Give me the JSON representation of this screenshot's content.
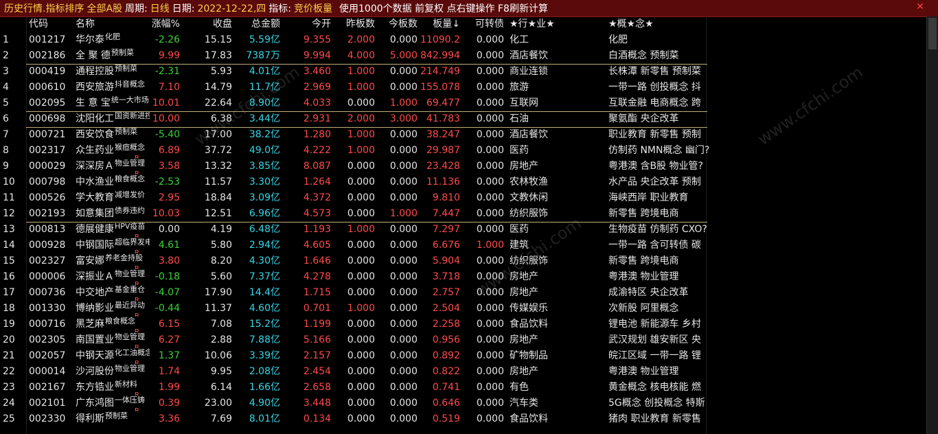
{
  "titlebar": {
    "title": "历史行情.指标排序",
    "market": "全部A股",
    "period_label": "周期:",
    "period_value": "日线",
    "date_label": "日期:",
    "date_value": "2022-12-22,四",
    "indicator_label": "指标:",
    "indicator_value": "竞价板量",
    "info": "使用1000个数据 前复权 点右键操作 F8刷新计算",
    "close": "✕"
  },
  "watermark": "www.cfchi.com",
  "headers": [
    "代码",
    "名称",
    "涨幅%",
    "收盘",
    "总金额",
    "今开",
    "昨板数",
    "今板数",
    "板量↓",
    "可转债",
    "★行★业★",
    "★概★念★"
  ],
  "rows": [
    {
      "idx": "1",
      "code": "001217",
      "name": "华尔泰",
      "tag": "化肥",
      "r": false,
      "pct": "-2.26",
      "close": "15.15",
      "amt": "5.59亿",
      "open": "9.355",
      "prev": "2.000",
      "today": "0.000",
      "board": "11090.2",
      "conv": "0.000",
      "ind": "化工",
      "con": "化肥",
      "pc": "green",
      "prc": "red",
      "tc": "white",
      "bc": "red",
      "cc": "white"
    },
    {
      "idx": "2",
      "code": "002186",
      "name": "全 聚 德",
      "tag": "预制菜",
      "r": false,
      "pct": "9.99",
      "close": "17.83",
      "amt": "7387万",
      "open": "9.994",
      "prev": "4.000",
      "today": "5.000",
      "board": "842.994",
      "conv": "0.000",
      "ind": "酒店餐饮",
      "con": "白酒概念 预制菜",
      "pc": "red",
      "prc": "red",
      "tc": "red",
      "bc": "red",
      "cc": "white"
    },
    {
      "idx": "3",
      "code": "000419",
      "name": "通程控股",
      "tag": "预制菜",
      "r": false,
      "pct": "-2.31",
      "close": "5.93",
      "amt": "4.01亿",
      "open": "3.460",
      "prev": "1.000",
      "today": "0.000",
      "board": "214.749",
      "conv": "0.000",
      "ind": "商业连锁",
      "con": "长株潭 新零售 预制菜",
      "pc": "green",
      "prc": "red",
      "tc": "white",
      "bc": "red",
      "cc": "white"
    },
    {
      "idx": "4",
      "code": "000610",
      "name": "西安旅游",
      "tag": "抖音概念",
      "r": false,
      "pct": "7.10",
      "close": "14.79",
      "amt": "11.7亿",
      "open": "2.969",
      "prev": "1.000",
      "today": "0.000",
      "board": "155.078",
      "conv": "0.000",
      "ind": "旅游",
      "con": "一带一路 创投概念 抖",
      "pc": "red",
      "prc": "red",
      "tc": "white",
      "bc": "red",
      "cc": "white"
    },
    {
      "idx": "5",
      "code": "002095",
      "name": "生 意 宝",
      "tag": "统一大市场",
      "r": false,
      "pct": "10.01",
      "close": "22.64",
      "amt": "8.90亿",
      "open": "4.033",
      "prev": "0.000",
      "today": "1.000",
      "board": "69.477",
      "conv": "0.000",
      "ind": "互联网",
      "con": "互联金融 电商概念 跨",
      "pc": "red",
      "prc": "white",
      "tc": "red",
      "bc": "red",
      "cc": "white"
    },
    {
      "idx": "6",
      "code": "000698",
      "name": "沈阳化工",
      "tag": "国资新进控股",
      "r": false,
      "pct": "10.00",
      "close": "6.38",
      "amt": "3.44亿",
      "open": "2.931",
      "prev": "2.000",
      "today": "3.000",
      "board": "41.783",
      "conv": "0.000",
      "ind": "石油",
      "con": "聚氨酯 央企改革",
      "pc": "red",
      "prc": "red",
      "tc": "red",
      "bc": "red",
      "cc": "white"
    },
    {
      "idx": "7",
      "code": "000721",
      "name": "西安饮食",
      "tag": "预制菜",
      "r": false,
      "pct": "-5.40",
      "close": "17.00",
      "amt": "38.2亿",
      "open": "1.280",
      "prev": "1.000",
      "today": "0.000",
      "board": "38.247",
      "conv": "0.000",
      "ind": "酒店餐饮",
      "con": "职业教育 新零售 预制",
      "pc": "green",
      "prc": "red",
      "tc": "white",
      "bc": "red",
      "cc": "white"
    },
    {
      "idx": "8",
      "code": "002317",
      "name": "众生药业",
      "tag": "猴痘概念",
      "r": true,
      "pct": "6.89",
      "close": "37.72",
      "amt": "49.0亿",
      "open": "4.222",
      "prev": "1.000",
      "today": "0.000",
      "board": "29.987",
      "conv": "0.000",
      "ind": "医药",
      "con": "仿制药 NMN概念 幽门?",
      "pc": "red",
      "prc": "red",
      "tc": "white",
      "bc": "red",
      "cc": "white"
    },
    {
      "idx": "9",
      "code": "000029",
      "name": "深深房Ａ",
      "tag": "物业管理",
      "r": true,
      "pct": "3.58",
      "close": "13.32",
      "amt": "3.85亿",
      "open": "8.087",
      "prev": "0.000",
      "today": "0.000",
      "board": "23.428",
      "conv": "0.000",
      "ind": "房地产",
      "con": "粤港澳 含B股 物业管?",
      "pc": "red",
      "prc": "white",
      "tc": "white",
      "bc": "red",
      "cc": "white"
    },
    {
      "idx": "10",
      "code": "000798",
      "name": "中水渔业",
      "tag": "粮食概念",
      "r": false,
      "pct": "-2.53",
      "close": "11.57",
      "amt": "3.30亿",
      "open": "1.264",
      "prev": "0.000",
      "today": "0.000",
      "board": "11.136",
      "conv": "0.000",
      "ind": "农林牧渔",
      "con": "水产品 央企改革 预制",
      "pc": "green",
      "prc": "white",
      "tc": "white",
      "bc": "red",
      "cc": "white"
    },
    {
      "idx": "11",
      "code": "000526",
      "name": "学大教育",
      "tag": "减增发价",
      "r": false,
      "pct": "2.95",
      "close": "18.84",
      "amt": "3.09亿",
      "open": "4.372",
      "prev": "0.000",
      "today": "0.000",
      "board": "9.810",
      "conv": "0.000",
      "ind": "文教休闲",
      "con": "海峡西岸 职业教育",
      "pc": "red",
      "prc": "white",
      "tc": "white",
      "bc": "red",
      "cc": "white"
    },
    {
      "idx": "12",
      "code": "002193",
      "name": "如意集团",
      "tag": "债券违约",
      "r": false,
      "pct": "10.03",
      "close": "12.51",
      "amt": "6.96亿",
      "open": "4.573",
      "prev": "0.000",
      "today": "1.000",
      "board": "7.447",
      "conv": "0.000",
      "ind": "纺织服饰",
      "con": "新零售 跨境电商",
      "pc": "red",
      "prc": "white",
      "tc": "red",
      "bc": "red",
      "cc": "white"
    },
    {
      "idx": "13",
      "code": "000813",
      "name": "德展健康",
      "tag": "HPV疫苗",
      "r": true,
      "pct": "0.00",
      "close": "4.19",
      "amt": "6.48亿",
      "open": "1.193",
      "prev": "1.000",
      "today": "0.000",
      "board": "7.297",
      "conv": "0.000",
      "ind": "医药",
      "con": "生物疫苗 仿制药 CXO?",
      "pc": "white",
      "prc": "red",
      "tc": "white",
      "bc": "red",
      "cc": "white"
    },
    {
      "idx": "14",
      "code": "000928",
      "name": "中钢国际",
      "tag": "超临界发电",
      "r": true,
      "pct": "4.61",
      "close": "5.80",
      "amt": "2.94亿",
      "open": "4.605",
      "prev": "0.000",
      "today": "0.000",
      "board": "6.676",
      "conv": "1.000",
      "ind": "建筑",
      "con": "一带一路 含可转债 碳",
      "pc": "green",
      "prc": "white",
      "tc": "white",
      "bc": "red",
      "cc": "red"
    },
    {
      "idx": "15",
      "code": "002327",
      "name": "富安娜",
      "tag": "养老金持股",
      "r": true,
      "pct": "3.80",
      "close": "8.20",
      "amt": "4.30亿",
      "open": "1.646",
      "prev": "0.000",
      "today": "0.000",
      "board": "5.904",
      "conv": "0.000",
      "ind": "纺织服饰",
      "con": "新零售 跨境电商",
      "pc": "red",
      "prc": "white",
      "tc": "white",
      "bc": "red",
      "cc": "white"
    },
    {
      "idx": "16",
      "code": "000006",
      "name": "深振业Ａ",
      "tag": "物业管理",
      "r": true,
      "pct": "-0.18",
      "close": "5.60",
      "amt": "7.37亿",
      "open": "4.278",
      "prev": "0.000",
      "today": "0.000",
      "board": "3.718",
      "conv": "0.000",
      "ind": "房地产",
      "con": "粤港澳 物业管理",
      "pc": "green",
      "prc": "white",
      "tc": "white",
      "bc": "red",
      "cc": "white"
    },
    {
      "idx": "17",
      "code": "000736",
      "name": "中交地产",
      "tag": "基金重仓",
      "r": true,
      "pct": "-4.07",
      "close": "17.90",
      "amt": "14.4亿",
      "open": "1.715",
      "prev": "0.000",
      "today": "0.000",
      "board": "2.757",
      "conv": "0.000",
      "ind": "房地产",
      "con": "成渝特区 央企改革",
      "pc": "green",
      "prc": "white",
      "tc": "white",
      "bc": "red",
      "cc": "white"
    },
    {
      "idx": "18",
      "code": "001330",
      "name": "博纳影业",
      "tag": "最近异动",
      "r": true,
      "pct": "-0.44",
      "close": "11.37",
      "amt": "4.60亿",
      "open": "0.701",
      "prev": "1.000",
      "today": "0.000",
      "board": "2.504",
      "conv": "0.000",
      "ind": "传媒娱乐",
      "con": "次新股 阿里概念",
      "pc": "green",
      "prc": "red",
      "tc": "white",
      "bc": "red",
      "cc": "white"
    },
    {
      "idx": "19",
      "code": "000716",
      "name": "黑芝麻",
      "tag": "粮食概念",
      "r": true,
      "pct": "6.15",
      "close": "7.08",
      "amt": "15.2亿",
      "open": "1.199",
      "prev": "0.000",
      "today": "0.000",
      "board": "2.258",
      "conv": "0.000",
      "ind": "食品饮料",
      "con": "锂电池 新能源车 乡村",
      "pc": "red",
      "prc": "white",
      "tc": "white",
      "bc": "red",
      "cc": "white"
    },
    {
      "idx": "20",
      "code": "002305",
      "name": "南国置业",
      "tag": "物业管理",
      "r": true,
      "pct": "6.27",
      "close": "2.88",
      "amt": "7.88亿",
      "open": "5.166",
      "prev": "0.000",
      "today": "0.000",
      "board": "0.956",
      "conv": "0.000",
      "ind": "房地产",
      "con": "武汉规划 雄安新区 央",
      "pc": "red",
      "prc": "white",
      "tc": "white",
      "bc": "red",
      "cc": "white"
    },
    {
      "idx": "21",
      "code": "002057",
      "name": "中钢天源",
      "tag": "化工油概念",
      "r": true,
      "pct": "1.37",
      "close": "10.06",
      "amt": "3.39亿",
      "open": "2.157",
      "prev": "0.000",
      "today": "0.000",
      "board": "0.892",
      "conv": "0.000",
      "ind": "矿物制品",
      "con": "皖江区域 一带一路 锂",
      "pc": "green",
      "prc": "white",
      "tc": "white",
      "bc": "red",
      "cc": "white"
    },
    {
      "idx": "22",
      "code": "000014",
      "name": "沙河股份",
      "tag": "物业管理",
      "r": false,
      "pct": "1.74",
      "close": "9.95",
      "amt": "2.08亿",
      "open": "2.454",
      "prev": "0.000",
      "today": "0.000",
      "board": "0.822",
      "conv": "0.000",
      "ind": "房地产",
      "con": "粤港澳 物业管理",
      "pc": "red",
      "prc": "white",
      "tc": "white",
      "bc": "red",
      "cc": "white"
    },
    {
      "idx": "23",
      "code": "002167",
      "name": "东方锆业",
      "tag": "新材料",
      "r": true,
      "pct": "1.99",
      "close": "6.14",
      "amt": "1.66亿",
      "open": "2.658",
      "prev": "0.000",
      "today": "0.000",
      "board": "0.741",
      "conv": "0.000",
      "ind": "有色",
      "con": "黄金概念 核电核能 燃",
      "pc": "red",
      "prc": "white",
      "tc": "white",
      "bc": "red",
      "cc": "white"
    },
    {
      "idx": "24",
      "code": "002101",
      "name": "广东鸿图",
      "tag": "一体压铸",
      "r": true,
      "pct": "0.39",
      "close": "23.00",
      "amt": "4.90亿",
      "open": "3.448",
      "prev": "0.000",
      "today": "0.000",
      "board": "0.646",
      "conv": "0.000",
      "ind": "汽车类",
      "con": "5G概念 创投概念 特斯",
      "pc": "red",
      "prc": "white",
      "tc": "white",
      "bc": "red",
      "cc": "white"
    },
    {
      "idx": "25",
      "code": "002330",
      "name": "得利斯",
      "tag": "预制菜",
      "r": false,
      "pct": "3.36",
      "close": "7.69",
      "amt": "8.01亿",
      "open": "0.134",
      "prev": "0.000",
      "today": "0.000",
      "board": "0.519",
      "conv": "0.000",
      "ind": "食品饮料",
      "con": "猪肉 职业教育 新零售",
      "pc": "red",
      "prc": "white",
      "tc": "white",
      "bc": "red",
      "cc": "white"
    }
  ]
}
